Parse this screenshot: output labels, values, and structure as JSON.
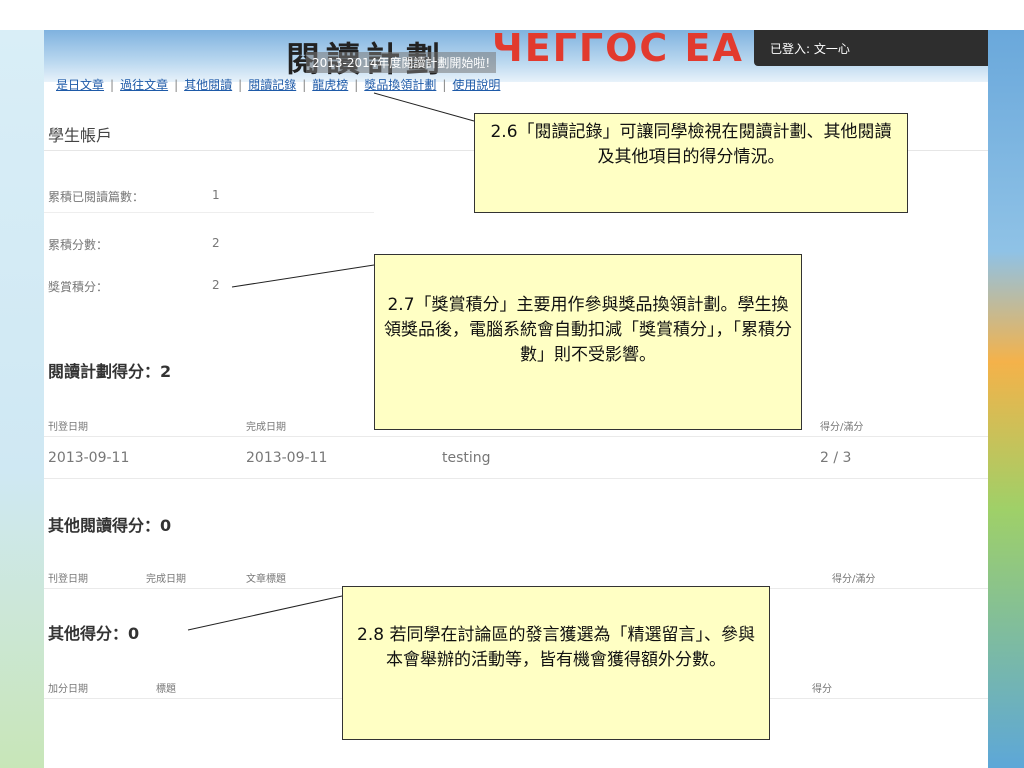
{
  "banner": {
    "title": "閱讀計劃",
    "deco": "ЧЕГГОС ЕА",
    "marquee": "2013-2014年度閱讀計劃開始啦!",
    "login": "已登入: 文一心"
  },
  "nav": {
    "items": [
      "是日文章",
      "過往文章",
      "其他閱讀",
      "閱讀記錄",
      "龍虎榜",
      "獎品換領計劃",
      "使用說明"
    ]
  },
  "account": {
    "title": "學生帳戶",
    "stats": [
      {
        "label": "累積已閱讀篇數：",
        "value": "1"
      },
      {
        "label": "累積分數：",
        "value": "2"
      },
      {
        "label": "獎賞積分：",
        "value": "2"
      }
    ]
  },
  "reading": {
    "heading": "閱讀計劃得分：2",
    "headers": {
      "date": "刊登日期",
      "done": "完成日期",
      "score": "得分/滿分"
    },
    "rows": [
      {
        "date": "2013-09-11",
        "done": "2013-09-11",
        "title": "testing",
        "score": "2 / 3"
      }
    ]
  },
  "other_reading": {
    "heading": "其他閱讀得分：0",
    "headers": {
      "date": "刊登日期",
      "done": "完成日期",
      "title": "文章標題",
      "score": "得分/滿分"
    }
  },
  "other_score": {
    "heading": "其他得分：0",
    "headers": {
      "date": "加分日期",
      "title": "標題",
      "score": "得分"
    }
  },
  "callouts": {
    "c1": "2.6「閱讀記錄」可讓同學檢視在閱讀計劃、其他閱讀及其他項目的得分情況。",
    "c2": "2.7「獎賞積分」主要用作參與獎品換領計劃。學生換領獎品後，電腦系統會自動扣減「獎賞積分」，「累積分數」則不受影響。",
    "c3": "2.8 若同學在討論區的發言獲選為「精選留言」、參與本會舉辦的活動等，皆有機會獲得額外分數。"
  }
}
